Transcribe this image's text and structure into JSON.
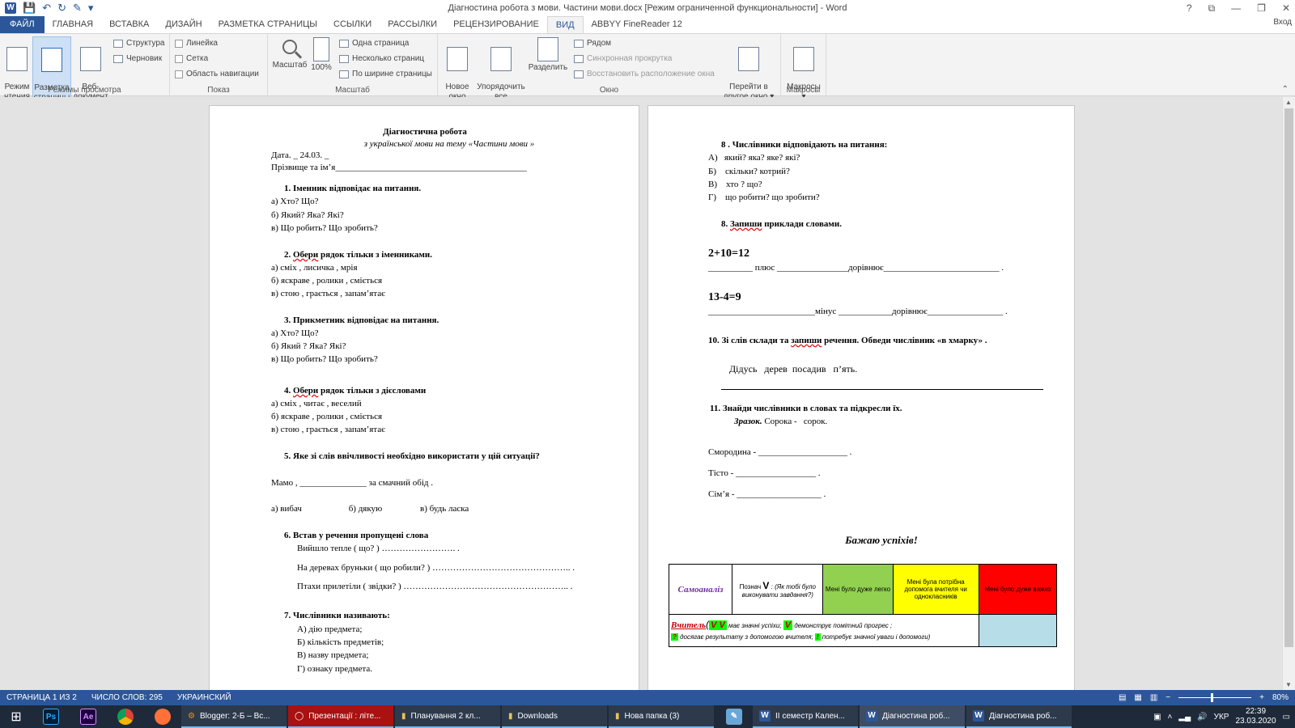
{
  "window": {
    "title": "Діагностина робота з мови. Частини мови.docx [Режим ограниченной функциональности] - Word",
    "signin": "Вход",
    "help": "?",
    "ribbon_display": "⧉",
    "minimize": "—",
    "restore": "❐",
    "close": "✕"
  },
  "qat": {
    "save": "💾",
    "undo": "↶",
    "redo": "↻",
    "touch": "✎",
    "more": "▾"
  },
  "tabs": [
    "ФАЙЛ",
    "ГЛАВНАЯ",
    "ВСТАВКА",
    "ДИЗАЙН",
    "РАЗМЕТКА СТРАНИЦЫ",
    "ССЫЛКИ",
    "РАССЫЛКИ",
    "РЕЦЕНЗИРОВАНИЕ",
    "ВИД",
    "ABBYY FineReader 12"
  ],
  "ribbon": {
    "views": {
      "label": "Режимы просмотра",
      "read": "Режим\nчтения",
      "layout": "Разметка\nстраницы",
      "web": "Веб-\nдокумент",
      "outline": "Структура",
      "draft": "Черновик"
    },
    "show": {
      "label": "Показ",
      "ruler": "Линейка",
      "grid": "Сетка",
      "nav": "Область навигации"
    },
    "zoom": {
      "label": "Масштаб",
      "zoom": "Масштаб",
      "hundred": "100%",
      "one_page": "Одна страница",
      "multi": "Несколько страниц",
      "width": "По ширине страницы"
    },
    "window": {
      "label": "Окно",
      "new": "Новое\nокно",
      "arrange": "Упорядочить\nвсе",
      "split": "Разделить",
      "side": "Рядом",
      "sync": "Синхронная прокрутка",
      "reset": "Восстановить расположение окна",
      "switch": "Перейти в\nдругое окно ▾"
    },
    "macros": {
      "label": "Макросы",
      "btn": "Макросы\n▾"
    }
  },
  "page1": {
    "title": "Діагностична робота",
    "subtitle": "з української мови на тему «Частини мови »",
    "date": "Дата. _ 24.03. _",
    "name": "Прізвище та ім’я___________________________________________",
    "q1": "1.  Іменник  відповідає на питання.",
    "q1a": "а) Хто? Що?",
    "q1b": "б) Який? Яка? Які?",
    "q1c": "в) Що робить? Що зробить?",
    "q2_num": "2.  ",
    "q2_word": "Обери",
    "q2_rest": " рядок  тільки з іменниками.",
    "q2a": "а) сміх , лисичка , мрія",
    "q2b": "б) яскраве , ролики , сміється",
    "q2c": "в) стою , грається , запам’ятає",
    "q3": "3.  Прикметник  відповідає на питання.",
    "q3a": "а) Хто? Що?",
    "q3b": "б) Який ? Яка? Які?",
    "q3c": "в) Що робить? Що зробить?",
    "q4_num": "4.  ",
    "q4_word": "Обери",
    "q4_rest": " рядок  тільки з дієсловами",
    "q4a": "а)  сміх , читає , веселий",
    "q4b": "б)  яскраве , ролики , сміється",
    "q4c": "в)  стою , грається , запам’ятає",
    "q5": "5. Яке зі слів ввічливості необхідно використати у цій ситуації?",
    "q5_line": "Мамо ,  _______________ за смачний обід .",
    "q5_opts": "а) вибач                     б) дякую                 в) будь ласка",
    "q6": "6.  Встав у речення пропущені слова",
    "q6a": "Вийшло тепле ( що? ) …………………….  .",
    "q6b": "На деревах бруньки ( що робили? ) ………………………………………..  .",
    "q6c": "Птахи прилетіли ( звідки? ) ………………………………………………..  .",
    "q7": "7.  Числівники називають:",
    "q7a": "А) дію предмета;",
    "q7b": "Б) кількість предметів;",
    "q7c": "В) назву предмета;",
    "q7d": "Г) ознаку предмета."
  },
  "page2": {
    "q8": "8 . Числівники відповідають на питання:",
    "q8a": "А)   який? яка? яке? які?",
    "q8b": "Б)    скільки? котрий?",
    "q8c": "В)    хто ? що?",
    "q8d": "Г)    що робити? що зробити?",
    "q9_num": "8.  ",
    "q9_word": "Запиши",
    "q9_rest": " приклади словами.",
    "ex1": "2+10=12",
    "ex1_line": "__________ плюс  ________________дорівнює__________________________ .",
    "ex2": "13-4=9",
    "ex2_line": "________________________мінус ____________дорівнює_________________  .",
    "q10_a": "10. Зі слів склади та ",
    "q10_word": "запиши",
    "q10_b": " речення. Обведи числівник «в хмарку» .",
    "q10_words": "Дідусь   дерев  посадив   п’ять.",
    "q11": "11. Знайди числівники в словах та підкресли їх.",
    "q11_sample_label": "Зразок.",
    "q11_sample": " Сорока -   сорок.",
    "q11a": "Смородина - ____________________ .",
    "q11b": "Тісто - __________________ .",
    "q11c": "Сім’я - ___________________ .",
    "wish": "Бажаю успіхів!",
    "sa": {
      "title": "Самоаналіз",
      "mark_a": "Познач ",
      "mark_v": "V",
      "mark_b": " :  (Як тобі було виконувати завдання?)",
      "easy": "Мені було дуже легко",
      "help": "Мені була потрібна допомога вчителя чи однокласників",
      "hard": "Мені було дуже важко",
      "teacher": "Вчитель",
      "vv": "V V",
      "t1": " має значні успіхи;  ",
      "v": "V",
      "t2": "  демонструє помітний прогрес ;",
      "q": "?",
      "t3": "  досягає результату з допомогою вчителя;  ",
      "ex": "!",
      "t4": "  потребує значної уваги і допомоги)"
    }
  },
  "status": {
    "page": "СТРАНИЦА 1 ИЗ 2",
    "words": "ЧИСЛО СЛОВ: 295",
    "lang": "УКРАИНСКИЙ",
    "zoom": "80%",
    "minus": "−",
    "plus": "+"
  },
  "taskbar": {
    "items": [
      "Blogger: 2-Б – Вс...",
      "Презентації : літе...",
      "Планування 2 кл...",
      "Downloads",
      "Нова папка (3)",
      "ІІ семестр  Кален...",
      "Діагностина роб...",
      "Діагностина роб..."
    ],
    "lang": "УКР",
    "time": "22:39",
    "date": "23.03.2020",
    "ps": "Ps",
    "ae": "Ae",
    "win": "⊞"
  },
  "colors": {
    "accent": "#2b579a",
    "easy": "#92d050",
    "help": "#ffff00",
    "hard": "#ff0000",
    "blank": "#b7dde8",
    "green": "#00ff00"
  }
}
